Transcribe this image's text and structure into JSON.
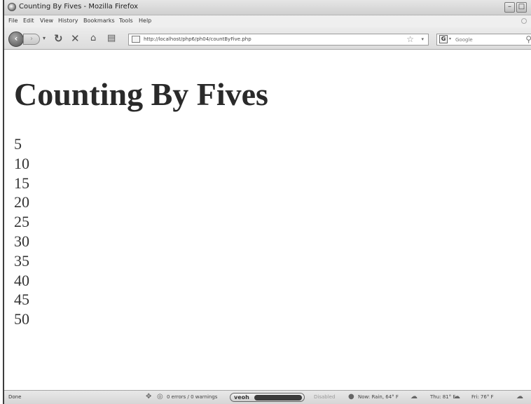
{
  "window": {
    "title": "Counting By Fives - Mozilla Firefox",
    "minimize_icon": "minimize-icon",
    "maximize_icon": "maximize-icon"
  },
  "menu": {
    "items": [
      "File",
      "Edit",
      "View",
      "History",
      "Bookmarks",
      "Tools",
      "Help"
    ]
  },
  "nav": {
    "url": "http://localhost/php6/ph04/countByFive.php",
    "search_placeholder": "Google"
  },
  "page": {
    "heading": "Counting By Fives",
    "numbers": [
      "5",
      "10",
      "15",
      "20",
      "25",
      "30",
      "35",
      "40",
      "45",
      "50"
    ]
  },
  "status": {
    "text": "Done",
    "errors": "0 errors / 0 warnings",
    "veoh": "veoh",
    "disabled": "Disabled",
    "weather_now": "Now: Rain, 64° F",
    "weather_thu": "Thu: 81° F",
    "weather_fri": "Fri: 76° F"
  }
}
